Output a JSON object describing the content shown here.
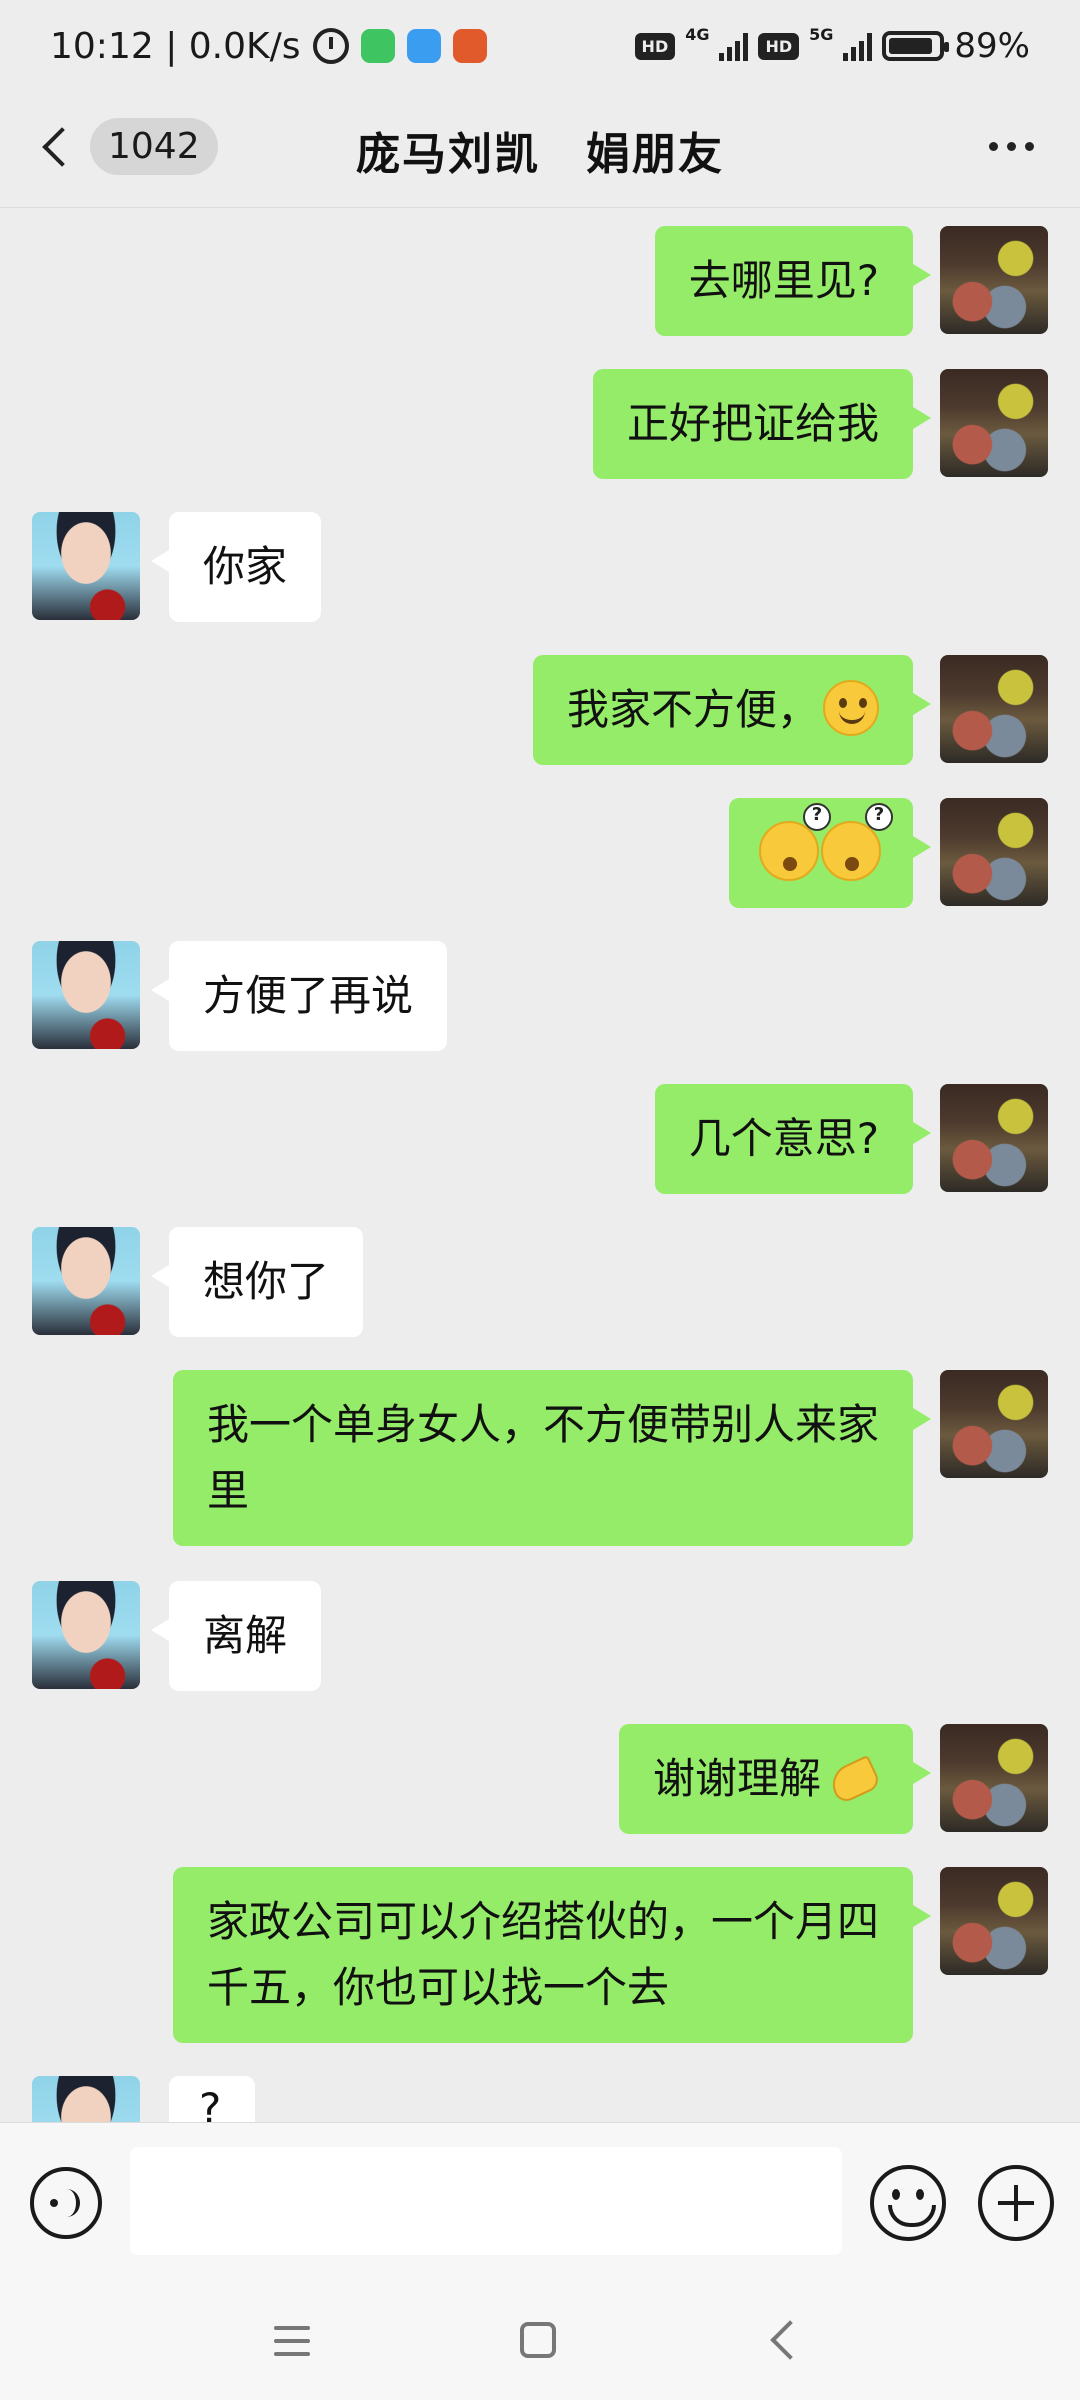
{
  "status_bar": {
    "time_speed": "10:12 | 0.0K/s",
    "hd1": "HD",
    "net1": "4G",
    "hd2": "HD",
    "net2": "5G",
    "battery": "89%",
    "battery_level": 0.89,
    "app_icon_colors": [
      "#3ec460",
      "#3a9df0",
      "#e05a2b"
    ]
  },
  "header": {
    "unread_count": "1042",
    "title": "庞马刘凯　娟朋友"
  },
  "messages": [
    {
      "side": "self",
      "text": "去哪里见?"
    },
    {
      "side": "self",
      "text": "正好把证给我"
    },
    {
      "side": "other",
      "text": "你家"
    },
    {
      "side": "self",
      "text": "我家不方便，",
      "emoji": "smile-icon"
    },
    {
      "side": "self",
      "text": "",
      "emoji": "confused-icon x2"
    },
    {
      "side": "other",
      "text": "方便了再说"
    },
    {
      "side": "self",
      "text": "几个意思?"
    },
    {
      "side": "other",
      "text": "想你了"
    },
    {
      "side": "self",
      "text": "我一个单身女人，不方便带别人来家里"
    },
    {
      "side": "other",
      "text": "离解"
    },
    {
      "side": "self",
      "text": "谢谢理解",
      "emoji": "praying-hands-icon"
    },
    {
      "side": "self",
      "text": "家政公司可以介绍搭伙的，一个月四千五，你也可以找一个去"
    },
    {
      "side": "other",
      "text": "?"
    }
  ],
  "input": {
    "placeholder": ""
  },
  "colors": {
    "background": "#ededed",
    "self_bubble": "#95ec69",
    "other_bubble": "#ffffff"
  }
}
